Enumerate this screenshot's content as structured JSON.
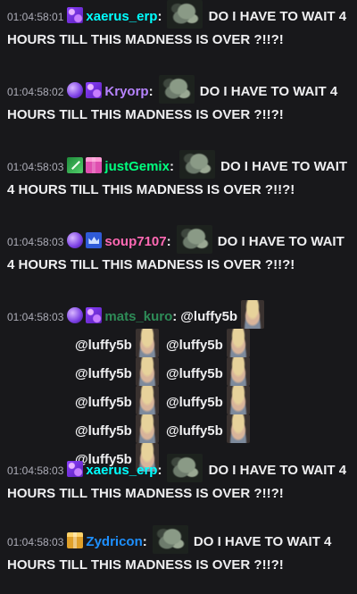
{
  "colors": {
    "background": "#18181b",
    "timestamp": "#adadb8",
    "text": "#efeff1",
    "xaerus_erp": "#00ffff",
    "Kryorp": "#b784ff",
    "justGemix": "#00ff7f",
    "soup7107": "#ff69b4",
    "mats_kuro": "#2e8b57",
    "Zydricon": "#1e90ff"
  },
  "messages": [
    {
      "timestamp": "01:04:58:01",
      "badges": [
        "sub-badge-icon"
      ],
      "username": "xaerus_erp",
      "colon": ":",
      "emote": "thinker-emote",
      "text": "DO I HAVE TO WAIT 4 HOURS TILL THIS MADNESS IS OVER ?!!?!"
    },
    {
      "timestamp": "01:04:58:02",
      "badges": [
        "gem-badge-icon",
        "sub-badge-icon"
      ],
      "username": "Kryorp",
      "colon": ":",
      "emote": "thinker-emote",
      "text": "DO I HAVE TO WAIT 4 HOURS TILL THIS MADNESS IS OVER ?!!?!"
    },
    {
      "timestamp": "01:04:58:03",
      "badges": [
        "sword-badge-icon",
        "gift-badge-icon"
      ],
      "username": "justGemix",
      "colon": ":",
      "emote": "thinker-emote",
      "text": "DO I HAVE TO WAIT 4 HOURS TILL THIS MADNESS IS OVER ?!!?!"
    },
    {
      "timestamp": "01:04:58:03",
      "badges": [
        "gem-badge-icon",
        "crown-badge-icon"
      ],
      "username": "soup7107",
      "colon": ":",
      "emote": "thinker-emote",
      "text": "DO I HAVE TO WAIT 4 HOURS TILL THIS MADNESS IS OVER ?!!?!"
    },
    {
      "timestamp": "01:04:58:03",
      "badges": [
        "gem-badge-icon",
        "sub-badge-icon"
      ],
      "username": "mats_kuro",
      "colon": ":",
      "mention": "@luffy5b",
      "emote": "face-emote"
    },
    {
      "timestamp": "01:04:58:03",
      "badges": [
        "sub-badge-icon"
      ],
      "username": "xaerus_erp",
      "colon": ":",
      "emote": "thinker-emote",
      "text": "DO I HAVE TO WAIT 4 HOURS TILL THIS MADNESS IS OVER ?!!?!"
    },
    {
      "timestamp": "01:04:58:03",
      "badges": [
        "gift-badge-icon"
      ],
      "username": "Zydricon",
      "colon": ":",
      "emote": "thinker-emote",
      "text": "DO I HAVE TO WAIT 4 HOURS TILL THIS MADNESS IS OVER ?!!?!"
    }
  ]
}
